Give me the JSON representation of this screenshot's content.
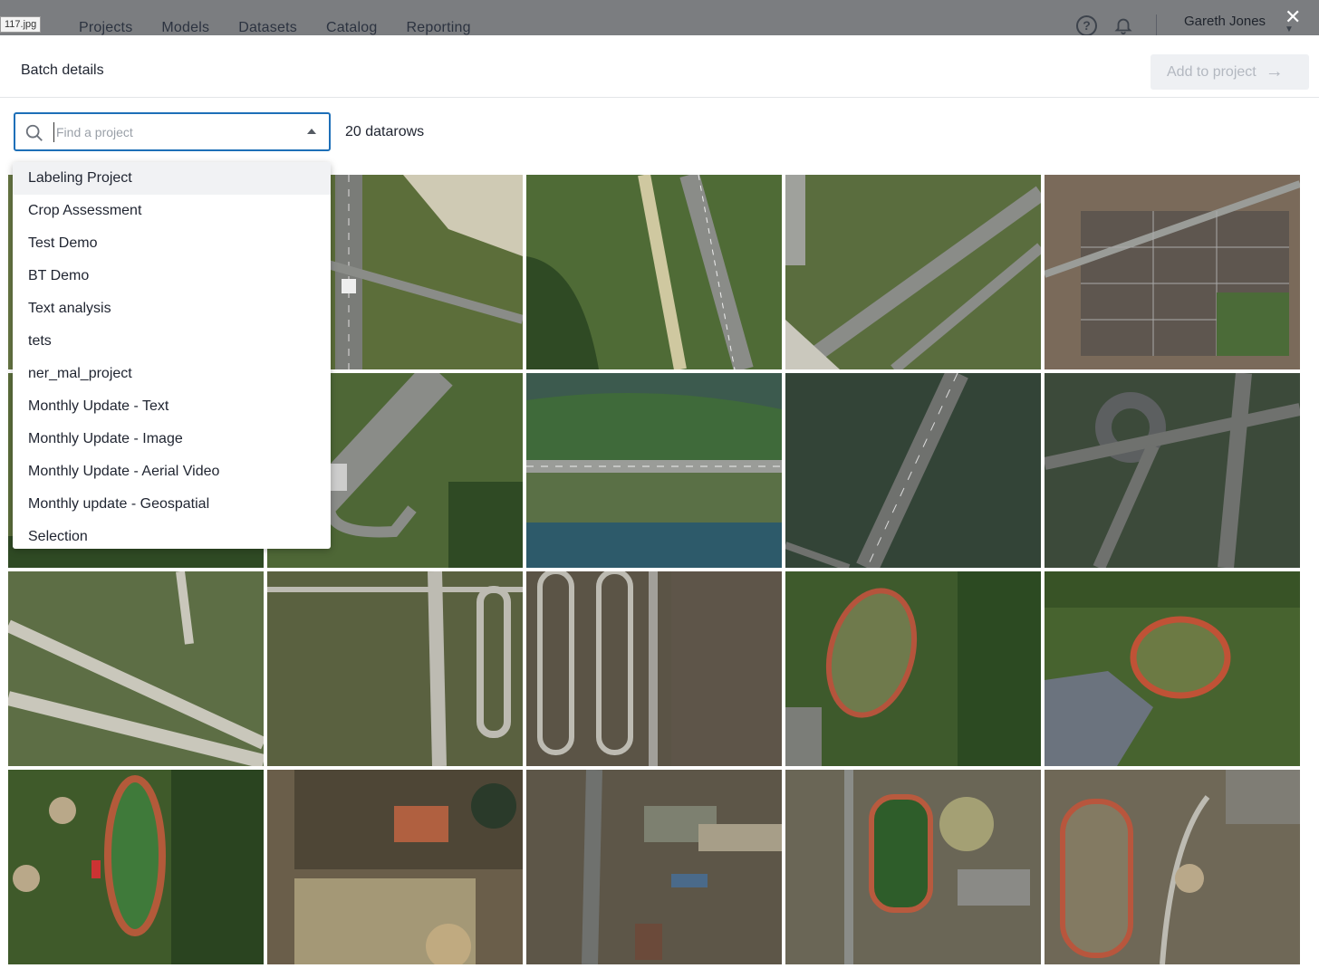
{
  "tab_tag": "117.jpg",
  "nav": {
    "links": [
      "Projects",
      "Models",
      "Datasets",
      "Catalog",
      "Reporting"
    ],
    "user_name": "Gareth Jones"
  },
  "modal": {
    "title": "Batch details",
    "add_button": "Add to project",
    "search_placeholder": "Find a project",
    "datarow_count": "20 datarows"
  },
  "dropdown_items": [
    "Labeling Project",
    "Crop Assessment",
    "Test Demo",
    "BT Demo",
    "Text analysis",
    "tets",
    "ner_mal_project",
    "Monthly Update - Text",
    "Monthly Update - Image",
    "Monthly Update - Aerial Video",
    "Monthly update - Geospatial",
    "Selection"
  ],
  "colors": {
    "accent": "#1d6fb8",
    "nav_overlay": "#7b7d80"
  }
}
